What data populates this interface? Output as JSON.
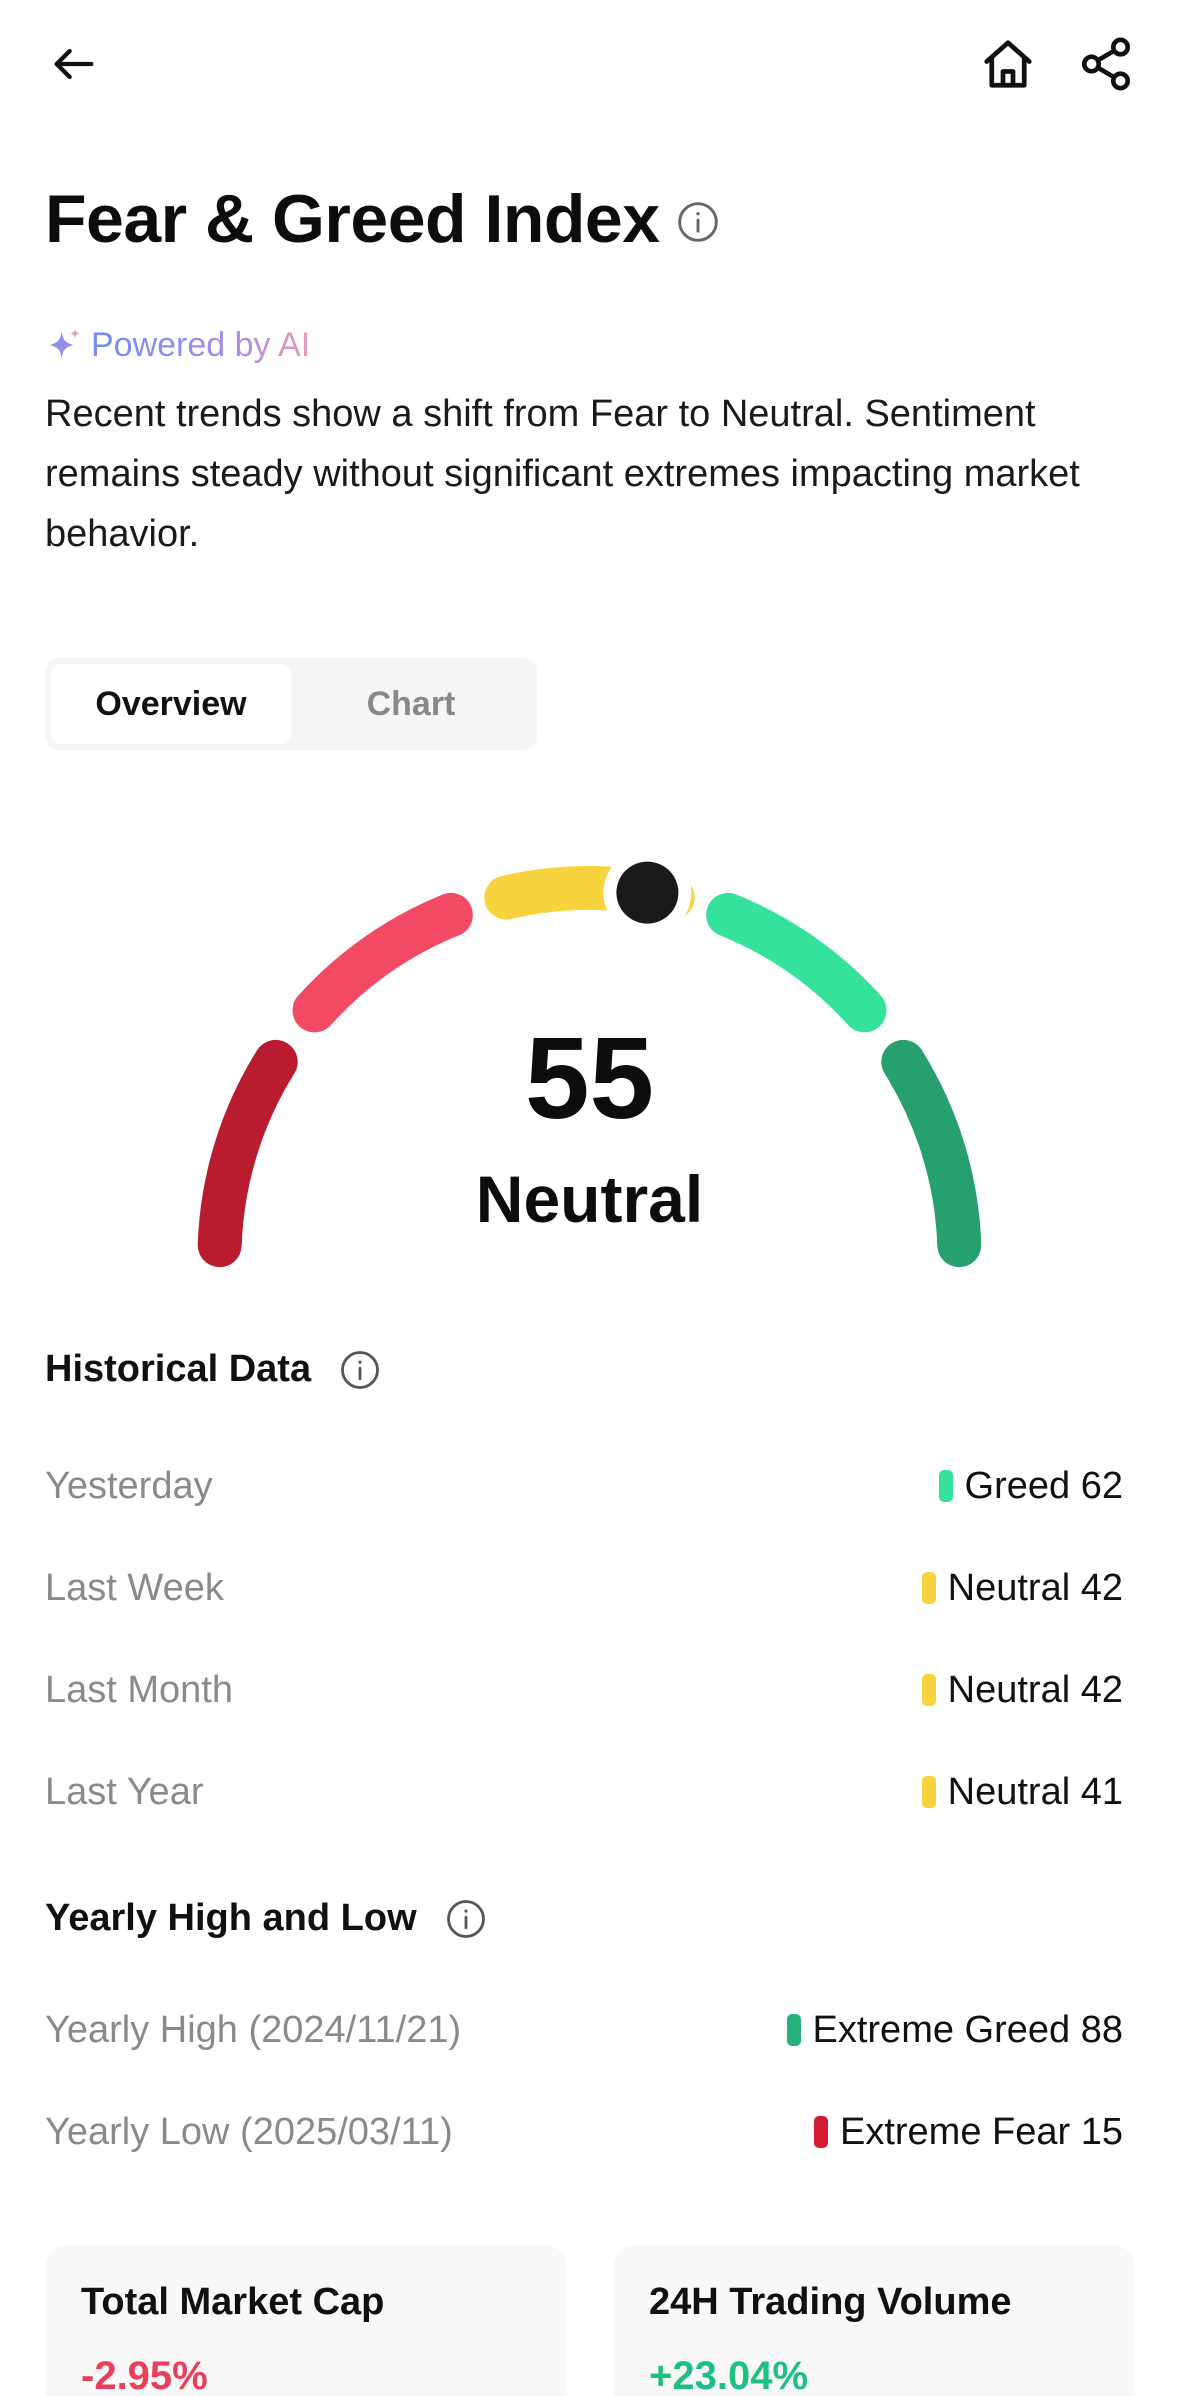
{
  "page": {
    "title": "Fear & Greed Index"
  },
  "ai": {
    "label": "Powered by AI",
    "summary": "Recent trends show a shift from Fear to Neutral. Sentiment remains steady without significant extremes impacting market behavior."
  },
  "tabs": [
    {
      "label": "Overview",
      "active": true
    },
    {
      "label": "Chart",
      "active": false
    }
  ],
  "gauge": {
    "value": "55",
    "level": 0.55,
    "label": "Neutral",
    "segment_colors": {
      "extreme_fear": "#b81c2e",
      "fear": "#f24a64",
      "neutral": "#f7d33d",
      "greed": "#35e29b",
      "extreme_greed": "#26a06e"
    },
    "needle_color": "#1a1a1a"
  },
  "historical": {
    "title": "Historical Data",
    "rows": [
      {
        "label": "Yesterday",
        "status": "Greed",
        "value": "62",
        "color": "#35e29b"
      },
      {
        "label": "Last Week",
        "status": "Neutral",
        "value": "42",
        "color": "#f7d33d"
      },
      {
        "label": "Last Month",
        "status": "Neutral",
        "value": "42",
        "color": "#f7d33d"
      },
      {
        "label": "Last Year",
        "status": "Neutral",
        "value": "41",
        "color": "#f7d33d"
      }
    ]
  },
  "yearly": {
    "title": "Yearly High and Low",
    "rows": [
      {
        "label": "Yearly High (2024/11/21)",
        "status": "Extreme Greed",
        "value": "88",
        "color": "#26b27a"
      },
      {
        "label": "Yearly Low (2025/03/11)",
        "status": "Extreme Fear",
        "value": "15",
        "color": "#d21c34"
      }
    ]
  },
  "cards": [
    {
      "title": "Total Market Cap",
      "change": "-2.95%",
      "color": "#e8405a"
    },
    {
      "title": "24H Trading Volume",
      "change": "+23.04%",
      "color": "#1fbf82"
    }
  ],
  "icons": {
    "back": "arrow-left-icon",
    "home": "home-icon",
    "share": "share-icon",
    "info": "info-icon",
    "spark": "sparkle-icon"
  }
}
